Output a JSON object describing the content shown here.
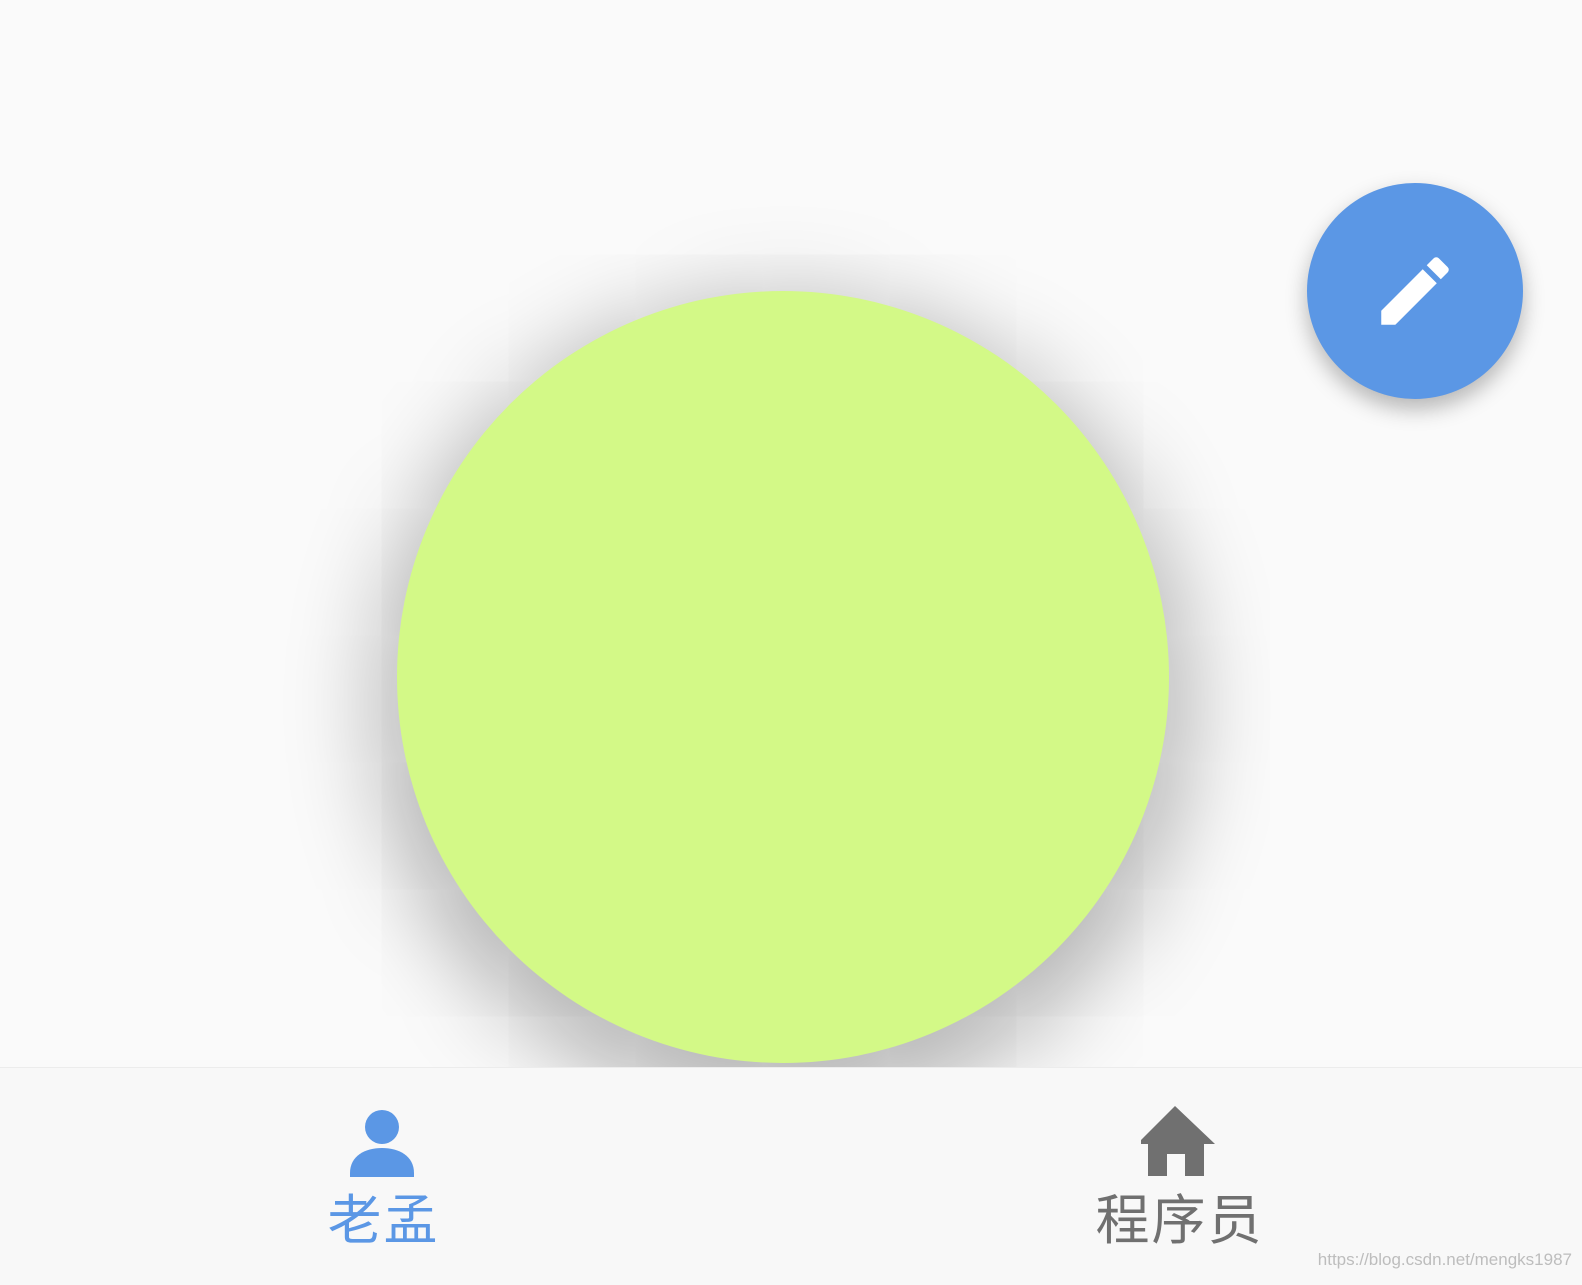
{
  "colors": {
    "page_background": "#fafafa",
    "bottom_nav_background": "#f8f8f8",
    "big_circle": "#d3f987",
    "fab_background": "#5b97e5",
    "fab_icon": "#ffffff",
    "active_nav": "#5b97e5",
    "inactive_nav": "#707070"
  },
  "fab": {
    "icon": "pencil-icon"
  },
  "bottom_nav": {
    "items": [
      {
        "icon": "person-icon",
        "label": "老孟",
        "active": true
      },
      {
        "icon": "home-icon",
        "label": "程序员",
        "active": false
      }
    ]
  },
  "watermark": "https://blog.csdn.net/mengks1987"
}
